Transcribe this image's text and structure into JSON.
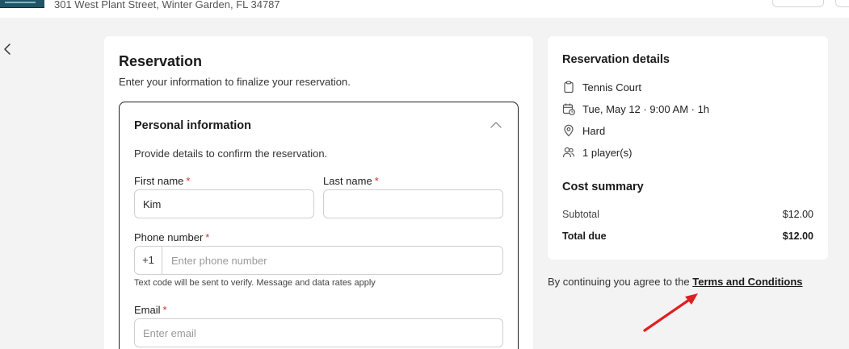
{
  "header": {
    "address": "301 West Plant Street, Winter Garden, FL 34787"
  },
  "reservation": {
    "title": "Reservation",
    "subtitle": "Enter your information to finalize your reservation."
  },
  "personal_info": {
    "title": "Personal information",
    "description": "Provide details to confirm the reservation.",
    "first_name": {
      "label": "First name",
      "required": "*",
      "value": "Kim"
    },
    "last_name": {
      "label": "Last name",
      "required": "*",
      "value": ""
    },
    "phone": {
      "label": "Phone number",
      "required": "*",
      "prefix": "+1",
      "placeholder": "Enter phone number",
      "hint": "Text code will be sent to verify. Message and data rates apply"
    },
    "email": {
      "label": "Email",
      "required": "*",
      "placeholder": "Enter email"
    }
  },
  "details": {
    "title": "Reservation details",
    "items": [
      {
        "icon": "clipboard-icon",
        "text": "Tennis Court"
      },
      {
        "icon": "calendar-clock-icon",
        "text": "Tue, May 12 · 9:00 AM · 1h"
      },
      {
        "icon": "location-pin-icon",
        "text": "Hard"
      },
      {
        "icon": "users-icon",
        "text": "1 player(s)"
      }
    ]
  },
  "cost_summary": {
    "title": "Cost summary",
    "subtotal_label": "Subtotal",
    "subtotal_value": "$12.00",
    "total_label": "Total due",
    "total_value": "$12.00"
  },
  "agreement": {
    "prefix": "By continuing you agree to the",
    "link": "Terms and Conditions"
  },
  "colors": {
    "background": "#f3f3f4",
    "required": "#d0312d",
    "annotation_arrow": "#e02020"
  }
}
